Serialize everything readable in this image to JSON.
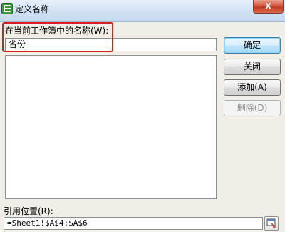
{
  "window": {
    "title": "定义名称",
    "app_icon": "spreadsheet-app-icon",
    "close_label": "x",
    "accent": "#d5543d"
  },
  "name_section": {
    "label": "在当前工作簿中的名称(W):",
    "value": "省份",
    "highlight_color": "#d71f1f"
  },
  "buttons": {
    "ok": "确定",
    "close": "关闭",
    "add": "添加(A)",
    "delete": "删除(D)"
  },
  "reference": {
    "label": "引用位置(R):",
    "value": "=Sheet1!$A$4:$A$6",
    "collapse_icon": "collapse-dialog-icon"
  }
}
